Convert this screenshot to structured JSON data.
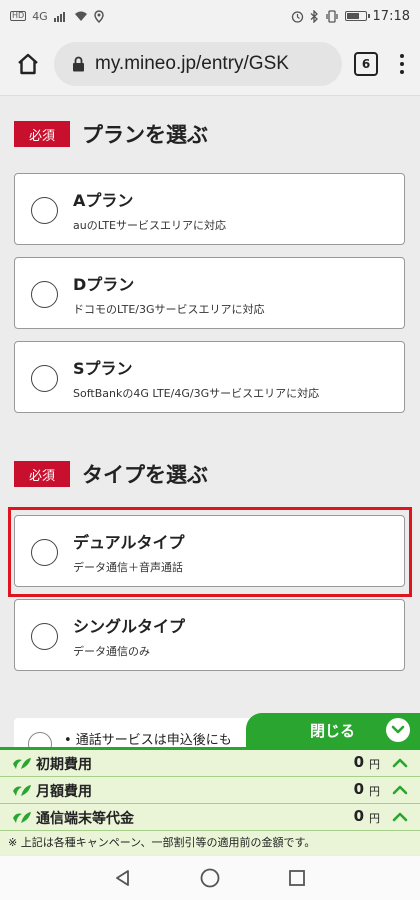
{
  "status_bar": {
    "left_badge": "HD",
    "network": "4G",
    "time": "17:18",
    "battery_level": 0.7
  },
  "browser": {
    "url": "my.mineo.jp/entry/GSK",
    "tab_count": "6"
  },
  "plan_section": {
    "badge": "必須",
    "title": "プランを選ぶ",
    "options": [
      {
        "name": "Aプラン",
        "desc": "auのLTEサービスエリアに対応"
      },
      {
        "name": "Dプラン",
        "desc": "ドコモのLTE/3Gサービスエリアに対応"
      },
      {
        "name": "Sプラン",
        "desc": "SoftBankの4G LTE/4G/3Gサービスエリアに対応"
      }
    ]
  },
  "type_section": {
    "badge": "必須",
    "title": "タイプを選ぶ",
    "options": [
      {
        "name": "デュアルタイプ",
        "desc": "データ通信＋音声通話"
      },
      {
        "name": "シングルタイプ",
        "desc": "データ通信のみ"
      }
    ]
  },
  "note": {
    "text": "• 通話サービスは申込後にも"
  },
  "close_tab": {
    "label": "閉じる"
  },
  "cost_panel": {
    "rows": [
      {
        "label": "初期費用",
        "value": "0",
        "unit": "円"
      },
      {
        "label": "月額費用",
        "value": "0",
        "unit": "円"
      },
      {
        "label": "通信端末等代金",
        "value": "0",
        "unit": "円"
      }
    ],
    "footnote": "※ 上記は各種キャンペーン、一部割引等の適用前の金額です。"
  },
  "colors": {
    "required_red": "#c8102e",
    "highlight_red": "#e0141e",
    "brand_green": "#2aa52f",
    "panel_bg": "#eaf5d8"
  },
  "icons": [
    "home-icon",
    "lock-icon",
    "tabs-icon",
    "more-vert-icon",
    "chevron-down-icon",
    "chevron-up-icon",
    "leaf-icon",
    "back-icon",
    "home-nav-icon",
    "recents-icon"
  ]
}
